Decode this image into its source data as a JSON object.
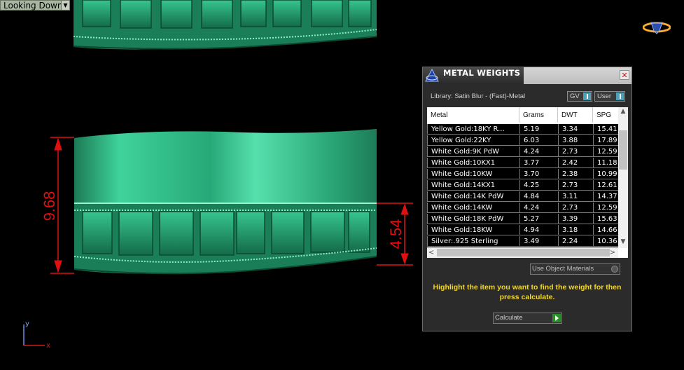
{
  "viewport": {
    "label": "Looking Down"
  },
  "dimensions": {
    "left": "9.68",
    "right": "4.54"
  },
  "axes": {
    "y": "y",
    "x": "x"
  },
  "panel": {
    "title": "METAL WEIGHTS",
    "library": "Library: Satin Blur - (Fast)-Metal",
    "gv_label": "GV",
    "user_label": "User",
    "columns": [
      "Metal",
      "Grams",
      "DWT",
      "SPG"
    ],
    "rows": [
      [
        "Yellow Gold:18KY R...",
        "5.19",
        "3.34",
        "15.41"
      ],
      [
        "Yellow Gold:22KY",
        "6.03",
        "3.88",
        "17.89"
      ],
      [
        "White Gold:9K PdW",
        "4.24",
        "2.73",
        "12.59"
      ],
      [
        "White Gold:10KX1",
        "3.77",
        "2.42",
        "11.18"
      ],
      [
        "White Gold:10KW",
        "3.70",
        "2.38",
        "10.99"
      ],
      [
        "White Gold:14KX1",
        "4.25",
        "2.73",
        "12.61"
      ],
      [
        "White Gold:14K PdW",
        "4.84",
        "3.11",
        "14.37"
      ],
      [
        "White Gold:14KW",
        "4.24",
        "2.73",
        "12.59"
      ],
      [
        "White Gold:18K PdW",
        "5.27",
        "3.39",
        "15.63"
      ],
      [
        "White Gold:18KW",
        "4.94",
        "3.18",
        "14.66"
      ],
      [
        "Silver:.925 Sterling",
        "3.49",
        "2.24",
        "10.36"
      ]
    ],
    "use_object_materials": "Use Object Materials",
    "instruction": "Highlight the item you want to find the weight for then press calculate.",
    "calculate_label": "Calculate"
  },
  "colors": {
    "model_green": "#2fb987",
    "dimension_red": "#e01010",
    "instruction_yellow": "#f0d62a"
  }
}
